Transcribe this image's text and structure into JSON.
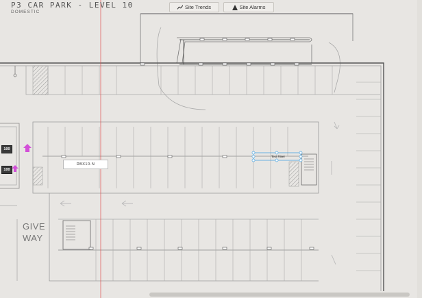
{
  "header": {
    "title": "P3 CAR PARK - LEVEL 10",
    "subtitle": "DOMESTIC"
  },
  "toolbar": {
    "site_trends_label": "Site Trends",
    "site_trends_icon": "trend-line-icon",
    "site_alarms_label": "Site Alarms",
    "site_alarms_icon": "warning-triangle-icon"
  },
  "plan": {
    "meter_label": "DBX10-N",
    "selected_label": "Text Riser",
    "badges": [
      "100",
      "100"
    ],
    "give_way_line1": "GIVE",
    "give_way_line2": "WAY",
    "accent_color": "#4aa3df",
    "marker_color": "#d34fd8",
    "guide_color": "#e05050"
  }
}
